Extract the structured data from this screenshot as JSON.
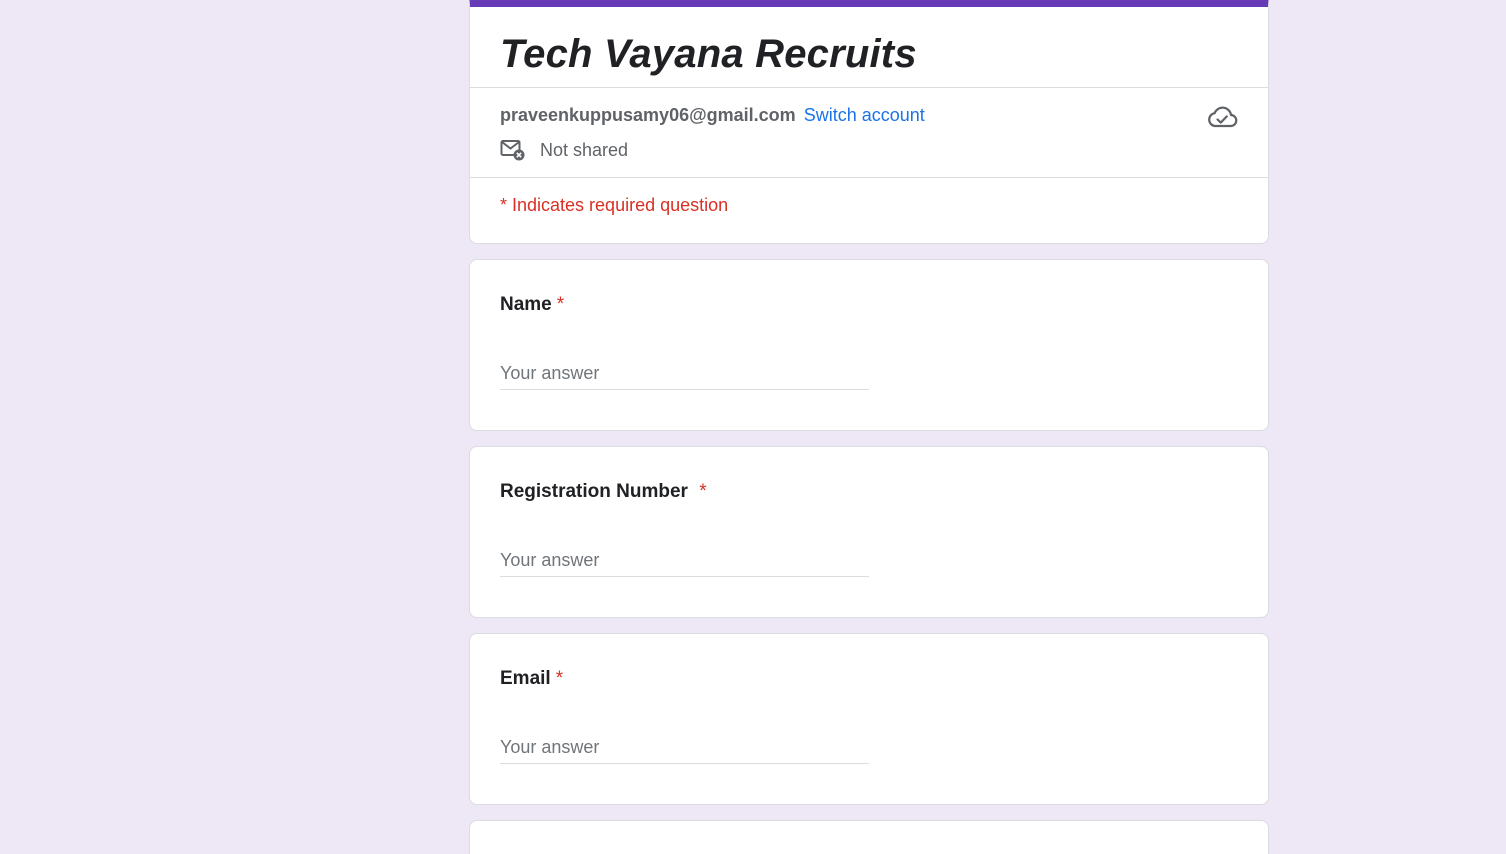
{
  "form": {
    "title": "Tech Vayana Recruits",
    "accent_color": "#673ab7",
    "background_color": "#ede7f6"
  },
  "account": {
    "email": "praveenkuppusamy06@gmail.com",
    "switch_label": "Switch account",
    "shared_status": "Not shared",
    "shared_icon": "mail-not-shared-icon",
    "save_status_icon": "cloud-saved-icon"
  },
  "required_note": "* Indicates required question",
  "questions": [
    {
      "label": "Name",
      "required_marker": "*",
      "placeholder": "Your answer"
    },
    {
      "label": "Registration Number ",
      "required_marker": "*",
      "placeholder": "Your answer"
    },
    {
      "label": "Email",
      "required_marker": "*",
      "placeholder": "Your answer"
    }
  ]
}
